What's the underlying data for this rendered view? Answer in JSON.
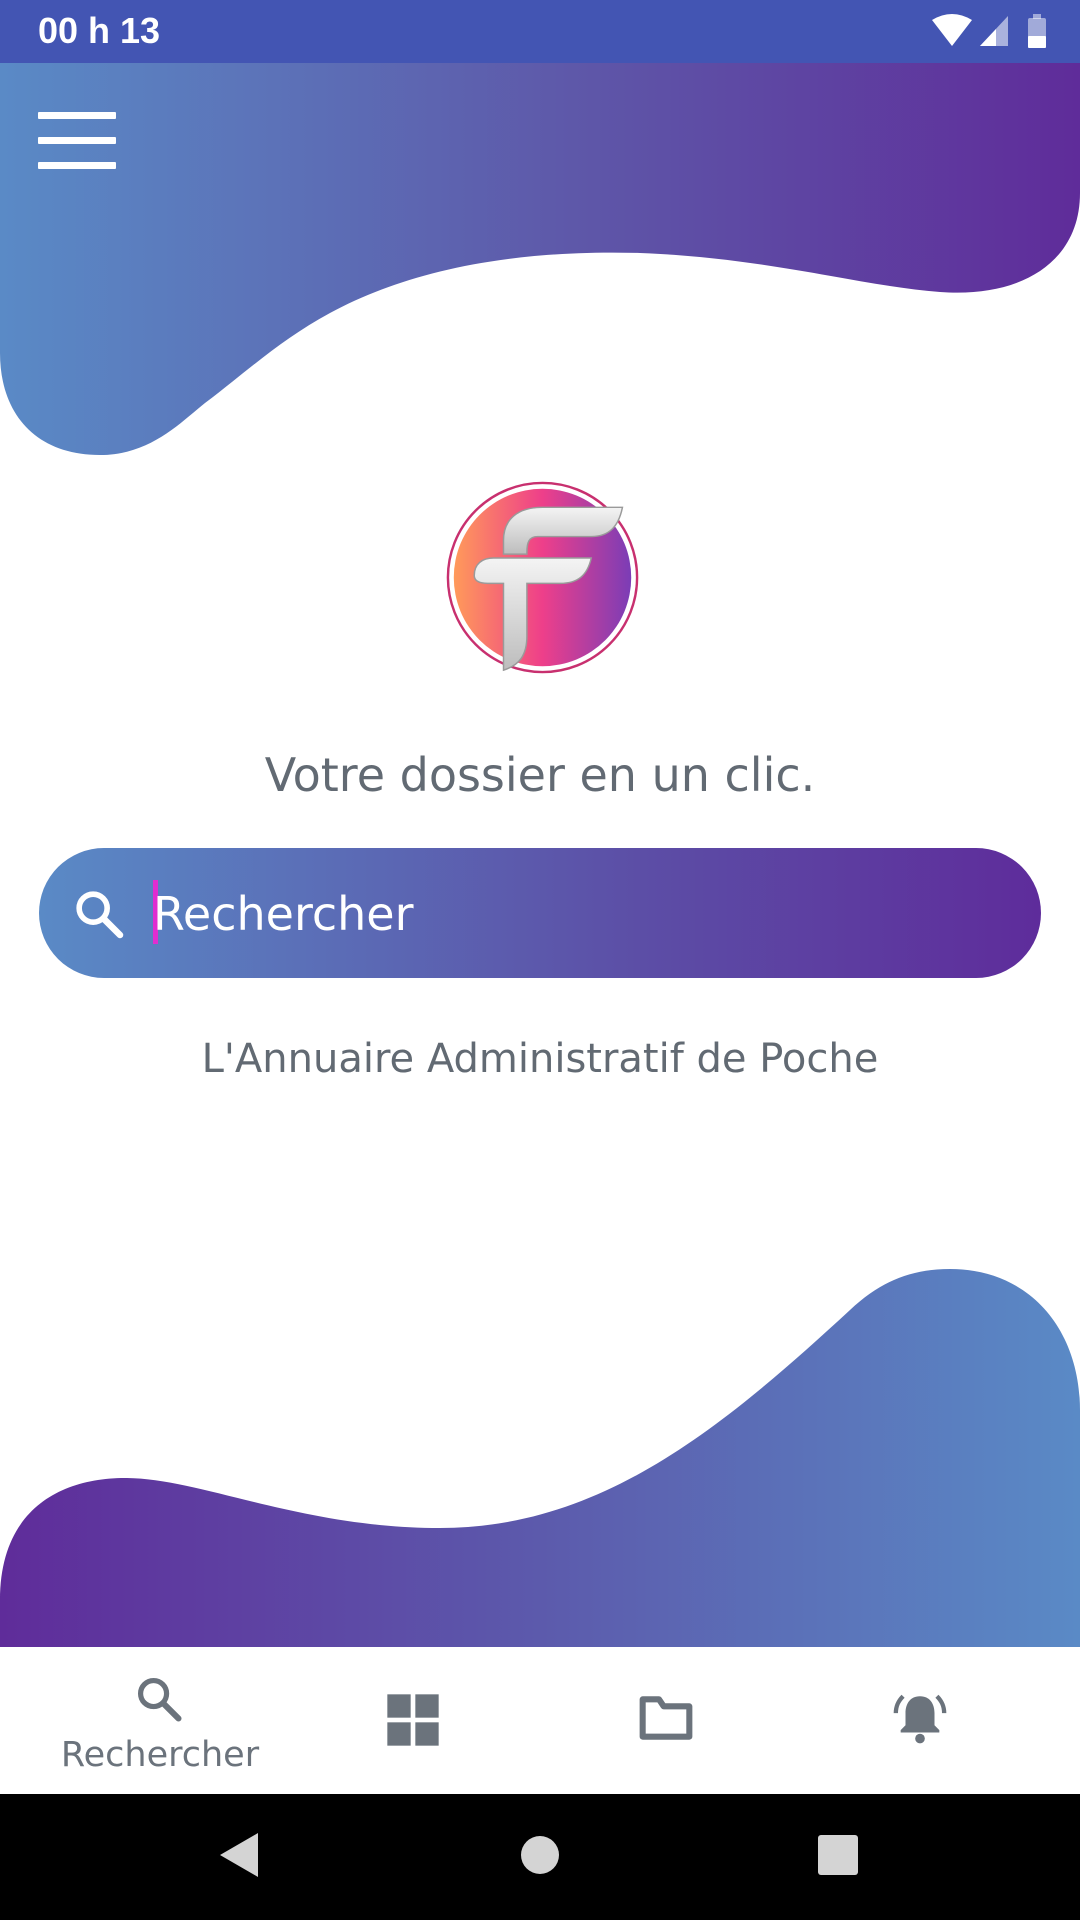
{
  "status_bar": {
    "time": "00 h 13",
    "icons": [
      "wifi-icon",
      "signal-icon",
      "battery-icon"
    ]
  },
  "header": {
    "menu_icon": "hamburger-menu-icon"
  },
  "main": {
    "tagline": "Votre dossier en un clic.",
    "search": {
      "placeholder": "Rechercher",
      "value": ""
    },
    "subtitle": "L'Annuaire Administratif de Poche"
  },
  "bottom_nav": {
    "items": [
      {
        "icon": "search-icon",
        "label": "Rechercher",
        "active": true
      },
      {
        "icon": "grid-icon",
        "label": "",
        "active": false
      },
      {
        "icon": "folder-icon",
        "label": "",
        "active": false
      },
      {
        "icon": "bell-icon",
        "label": "",
        "active": false
      }
    ]
  },
  "colors": {
    "status_bar": "#4355b3",
    "gradient_blue": "#5a8ac6",
    "gradient_purple": "#5e2c9b",
    "text_gray": "#626a73",
    "cursor": "#e02dd0"
  }
}
